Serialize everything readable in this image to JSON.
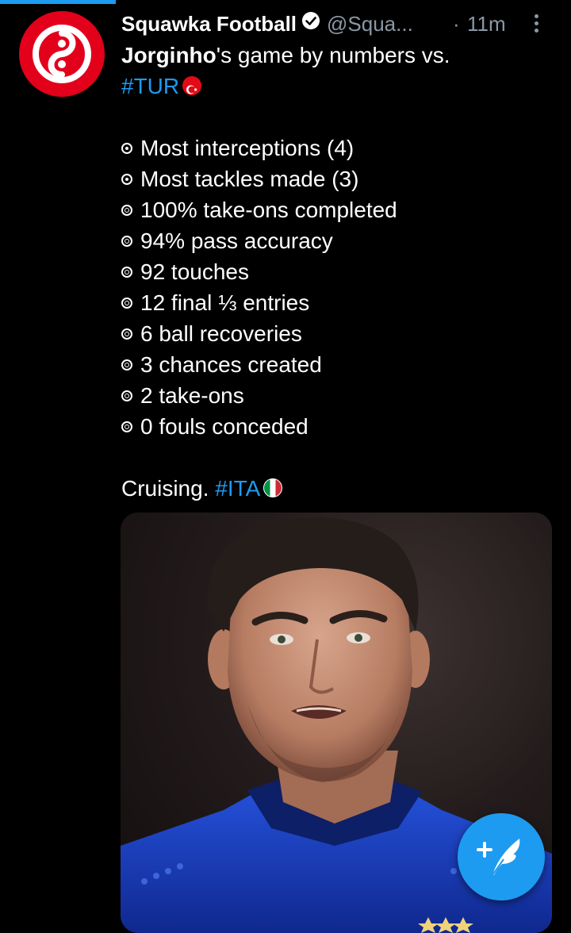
{
  "account": {
    "display_name": "Squawka Football",
    "handle": "@Squa...",
    "separator": "·",
    "time": "11m"
  },
  "tweet": {
    "name_bold": "Jorginho",
    "line1_rest": "'s game by numbers vs.",
    "hashtag_tur": "#TUR",
    "stats": [
      "Most interceptions (4)",
      "Most tackles made (3)",
      "100% take-ons completed",
      "94% pass accuracy",
      "92 touches",
      "12 final ⅓ entries",
      "6 ball recoveries",
      "3 chances created",
      "2 take-ons",
      "0 fouls conceded"
    ],
    "closing": "Cruising.",
    "hashtag_ita": "#ITA"
  },
  "icons": {
    "verified": "verified-badge-icon",
    "more": "more-vertical-icon",
    "compose": "compose-tweet-icon"
  },
  "colors": {
    "accent": "#1d9bf0",
    "muted": "#8b98a5",
    "avatar_red": "#e3001b",
    "kit_blue": "#1b3fbd"
  }
}
